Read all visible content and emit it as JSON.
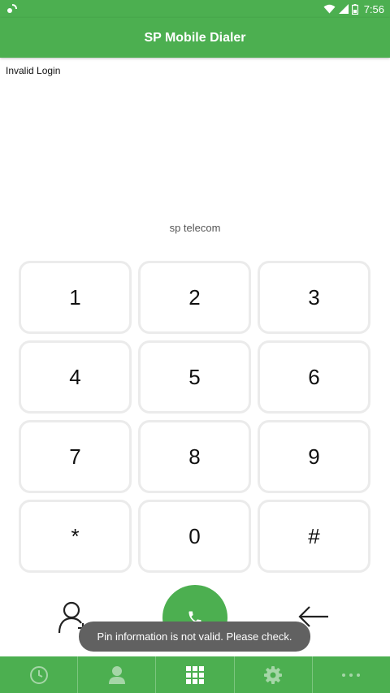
{
  "status_bar": {
    "time": "7:56"
  },
  "app_bar": {
    "title": "SP Mobile Dialer"
  },
  "login_status": "Invalid Login",
  "provider": "sp telecom",
  "keypad": {
    "keys": [
      "1",
      "2",
      "3",
      "4",
      "5",
      "6",
      "7",
      "8",
      "9",
      "*",
      "0",
      "#"
    ]
  },
  "toast": {
    "message": "Pin information is not valid. Please check."
  },
  "bottom_nav": {
    "items": [
      {
        "icon": "recent-icon"
      },
      {
        "icon": "contacts-icon"
      },
      {
        "icon": "dialpad-icon"
      },
      {
        "icon": "settings-icon"
      },
      {
        "icon": "more-icon"
      }
    ]
  },
  "colors": {
    "primary": "#4caf50",
    "key_border": "#ebebeb",
    "toast_bg": "#616161"
  }
}
